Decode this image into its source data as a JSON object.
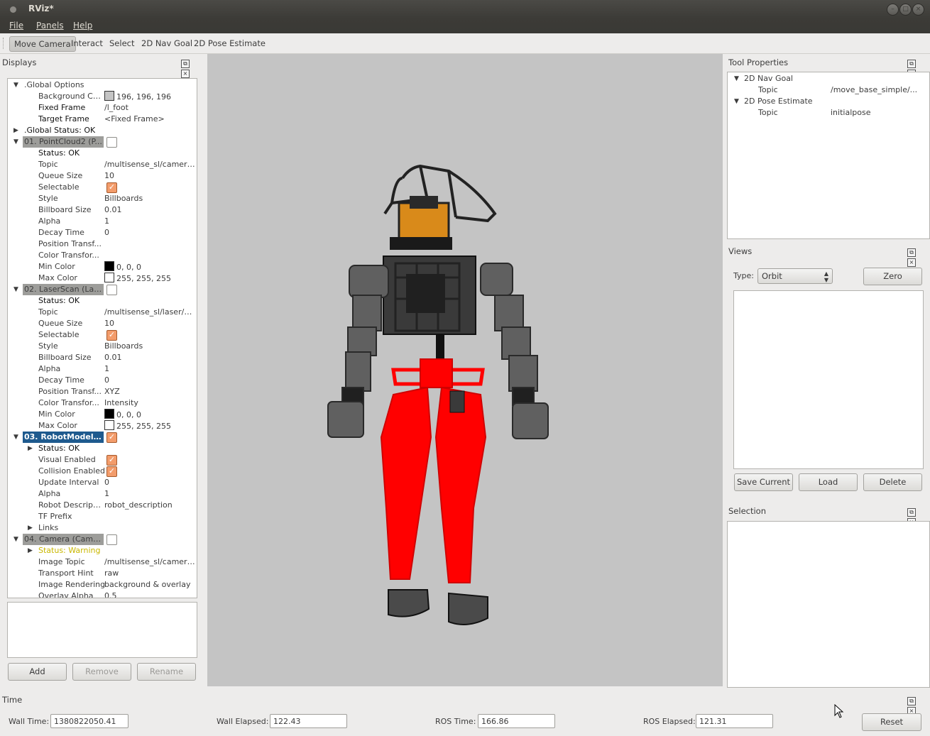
{
  "window": {
    "title": "RViz*"
  },
  "menu": {
    "file": "File",
    "panels": "Panels",
    "help": "Help"
  },
  "toolbar": {
    "move_camera": "Move Camera",
    "interact": "Interact",
    "select": "Select",
    "nav_goal": "2D Nav Goal",
    "pose_estimate": "2D Pose Estimate"
  },
  "displays": {
    "title": "Displays",
    "rows": [
      {
        "key": ".Global Options",
        "value": ""
      },
      {
        "key": "Background Co...",
        "value": "196, 196, 196"
      },
      {
        "key": "Fixed Frame",
        "value": "/l_foot"
      },
      {
        "key": "Target Frame",
        "value": "<Fixed Frame>"
      },
      {
        "key": ".Global Status: OK",
        "value": ""
      },
      {
        "key": "01. PointCloud2 (P...",
        "value": ""
      },
      {
        "key": "Status: OK",
        "value": ""
      },
      {
        "key": "Topic",
        "value": "/multisense_sl/camera..."
      },
      {
        "key": "Queue Size",
        "value": "10"
      },
      {
        "key": "Selectable",
        "value": ""
      },
      {
        "key": "Style",
        "value": "Billboards"
      },
      {
        "key": "Billboard Size",
        "value": "0.01"
      },
      {
        "key": "Alpha",
        "value": "1"
      },
      {
        "key": "Decay Time",
        "value": "0"
      },
      {
        "key": "Position Transf...",
        "value": ""
      },
      {
        "key": "Color Transfor...",
        "value": ""
      },
      {
        "key": "Min Color",
        "value": "0, 0, 0"
      },
      {
        "key": "Max Color",
        "value": "255, 255, 255"
      },
      {
        "key": "02. LaserScan (Lase...",
        "value": ""
      },
      {
        "key": "Status: OK",
        "value": ""
      },
      {
        "key": "Topic",
        "value": "/multisense_sl/laser/sc..."
      },
      {
        "key": "Queue Size",
        "value": "10"
      },
      {
        "key": "Selectable",
        "value": ""
      },
      {
        "key": "Style",
        "value": "Billboards"
      },
      {
        "key": "Billboard Size",
        "value": "0.01"
      },
      {
        "key": "Alpha",
        "value": "1"
      },
      {
        "key": "Decay Time",
        "value": "0"
      },
      {
        "key": "Position Transf...",
        "value": "XYZ"
      },
      {
        "key": "Color Transfor...",
        "value": "Intensity"
      },
      {
        "key": "Min Color",
        "value": "0, 0, 0"
      },
      {
        "key": "Max Color",
        "value": "255, 255, 255"
      },
      {
        "key": "03. RobotModel (...",
        "value": ""
      },
      {
        "key": "Status: OK",
        "value": ""
      },
      {
        "key": "Visual Enabled",
        "value": ""
      },
      {
        "key": "Collision Enabled",
        "value": ""
      },
      {
        "key": "Update Interval",
        "value": "0"
      },
      {
        "key": "Alpha",
        "value": "1"
      },
      {
        "key": "Robot Descript...",
        "value": "robot_description"
      },
      {
        "key": "TF Prefix",
        "value": ""
      },
      {
        "key": "Links",
        "value": ""
      },
      {
        "key": "04. Camera (Camera)",
        "value": ""
      },
      {
        "key": "Status: Warning",
        "value": ""
      },
      {
        "key": "Image Topic",
        "value": "/multisense_sl/camera..."
      },
      {
        "key": "Transport Hint",
        "value": "raw"
      },
      {
        "key": "Image Rendering",
        "value": "background & overlay"
      },
      {
        "key": "Overlay Alpha",
        "value": "0.5"
      }
    ],
    "buttons": {
      "add": "Add",
      "remove": "Remove",
      "rename": "Rename"
    }
  },
  "tool_properties": {
    "title": "Tool Properties",
    "rows": [
      {
        "key": "2D Nav Goal",
        "value": ""
      },
      {
        "key": "Topic",
        "value": "/move_base_simple/..."
      },
      {
        "key": "2D Pose Estimate",
        "value": ""
      },
      {
        "key": "Topic",
        "value": "initialpose"
      }
    ]
  },
  "views": {
    "title": "Views",
    "type_label": "Type:",
    "type_value": "Orbit",
    "zero": "Zero",
    "save_current": "Save Current",
    "load": "Load",
    "delete": "Delete"
  },
  "selection": {
    "title": "Selection"
  },
  "time": {
    "title": "Time",
    "wall_time_label": "Wall Time:",
    "wall_time": "1380822050.41",
    "wall_elapsed_label": "Wall Elapsed:",
    "wall_elapsed": "122.43",
    "ros_time_label": "ROS Time:",
    "ros_time": "166.86",
    "ros_elapsed_label": "ROS Elapsed:",
    "ros_elapsed": "121.31",
    "reset": "Reset"
  },
  "colors": {
    "viewport_bg": "#c4c4c4",
    "selected_row": "#1e5a8e",
    "check_on": "#f39c6b",
    "collision": "#ff0000"
  }
}
